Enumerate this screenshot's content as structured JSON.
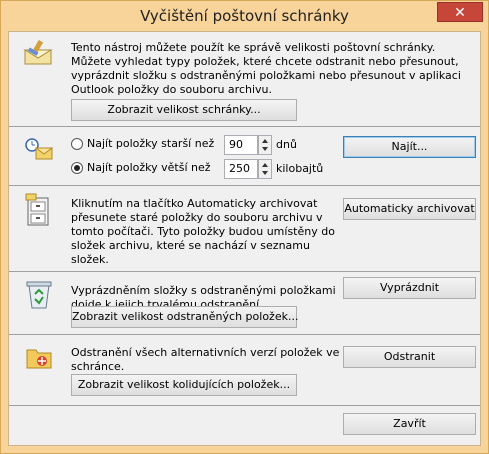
{
  "window": {
    "title": "Vyčištění poštovní schránky",
    "close_label": "✕"
  },
  "section1": {
    "text_line1": "Tento nástroj můžete použít ke správě velikosti poštovní schránky.",
    "text_line2": "Můžete vyhledat typy položek, které chcete odstranit nebo přesunout,",
    "text_line3": "vyprázdnit složku s odstraněnými položkami nebo přesunout v aplikaci",
    "text_line4": "Outlook položky do souboru archivu.",
    "button": "Zobrazit velikost schránky..."
  },
  "section2": {
    "radio_older_label": "Najít položky starší než",
    "radio_older_checked": false,
    "older_value": "90",
    "older_unit": "dnů",
    "radio_larger_label": "Najít položky větší než",
    "radio_larger_checked": true,
    "larger_value": "250",
    "larger_unit": "kilobajtů",
    "find_button": "Najít..."
  },
  "section3": {
    "text_line1": "Kliknutím na tlačítko Automaticky archivovat",
    "text_line2": "přesunete staré položky do souboru archivu v",
    "text_line3": "tomto počítači. Tyto položky budou umístěny do",
    "text_line4": "složek archivu, které se nachází v seznamu",
    "text_line5": "složek.",
    "button": "Automaticky archivovat"
  },
  "section4": {
    "text_line1": "Vyprázdněním složky s odstraněnými položkami",
    "text_line2": "dojde k jejich trvalému odstranění.",
    "empty_button": "Vyprázdnit",
    "size_button": "Zobrazit velikost odstraněných položek..."
  },
  "section5": {
    "text_line1": "Odstranění všech alternativních verzí položek ve",
    "text_line2": "schránce.",
    "delete_button": "Odstranit",
    "size_button": "Zobrazit velikost kolidujících položek..."
  },
  "footer": {
    "close_button": "Zavřít"
  }
}
